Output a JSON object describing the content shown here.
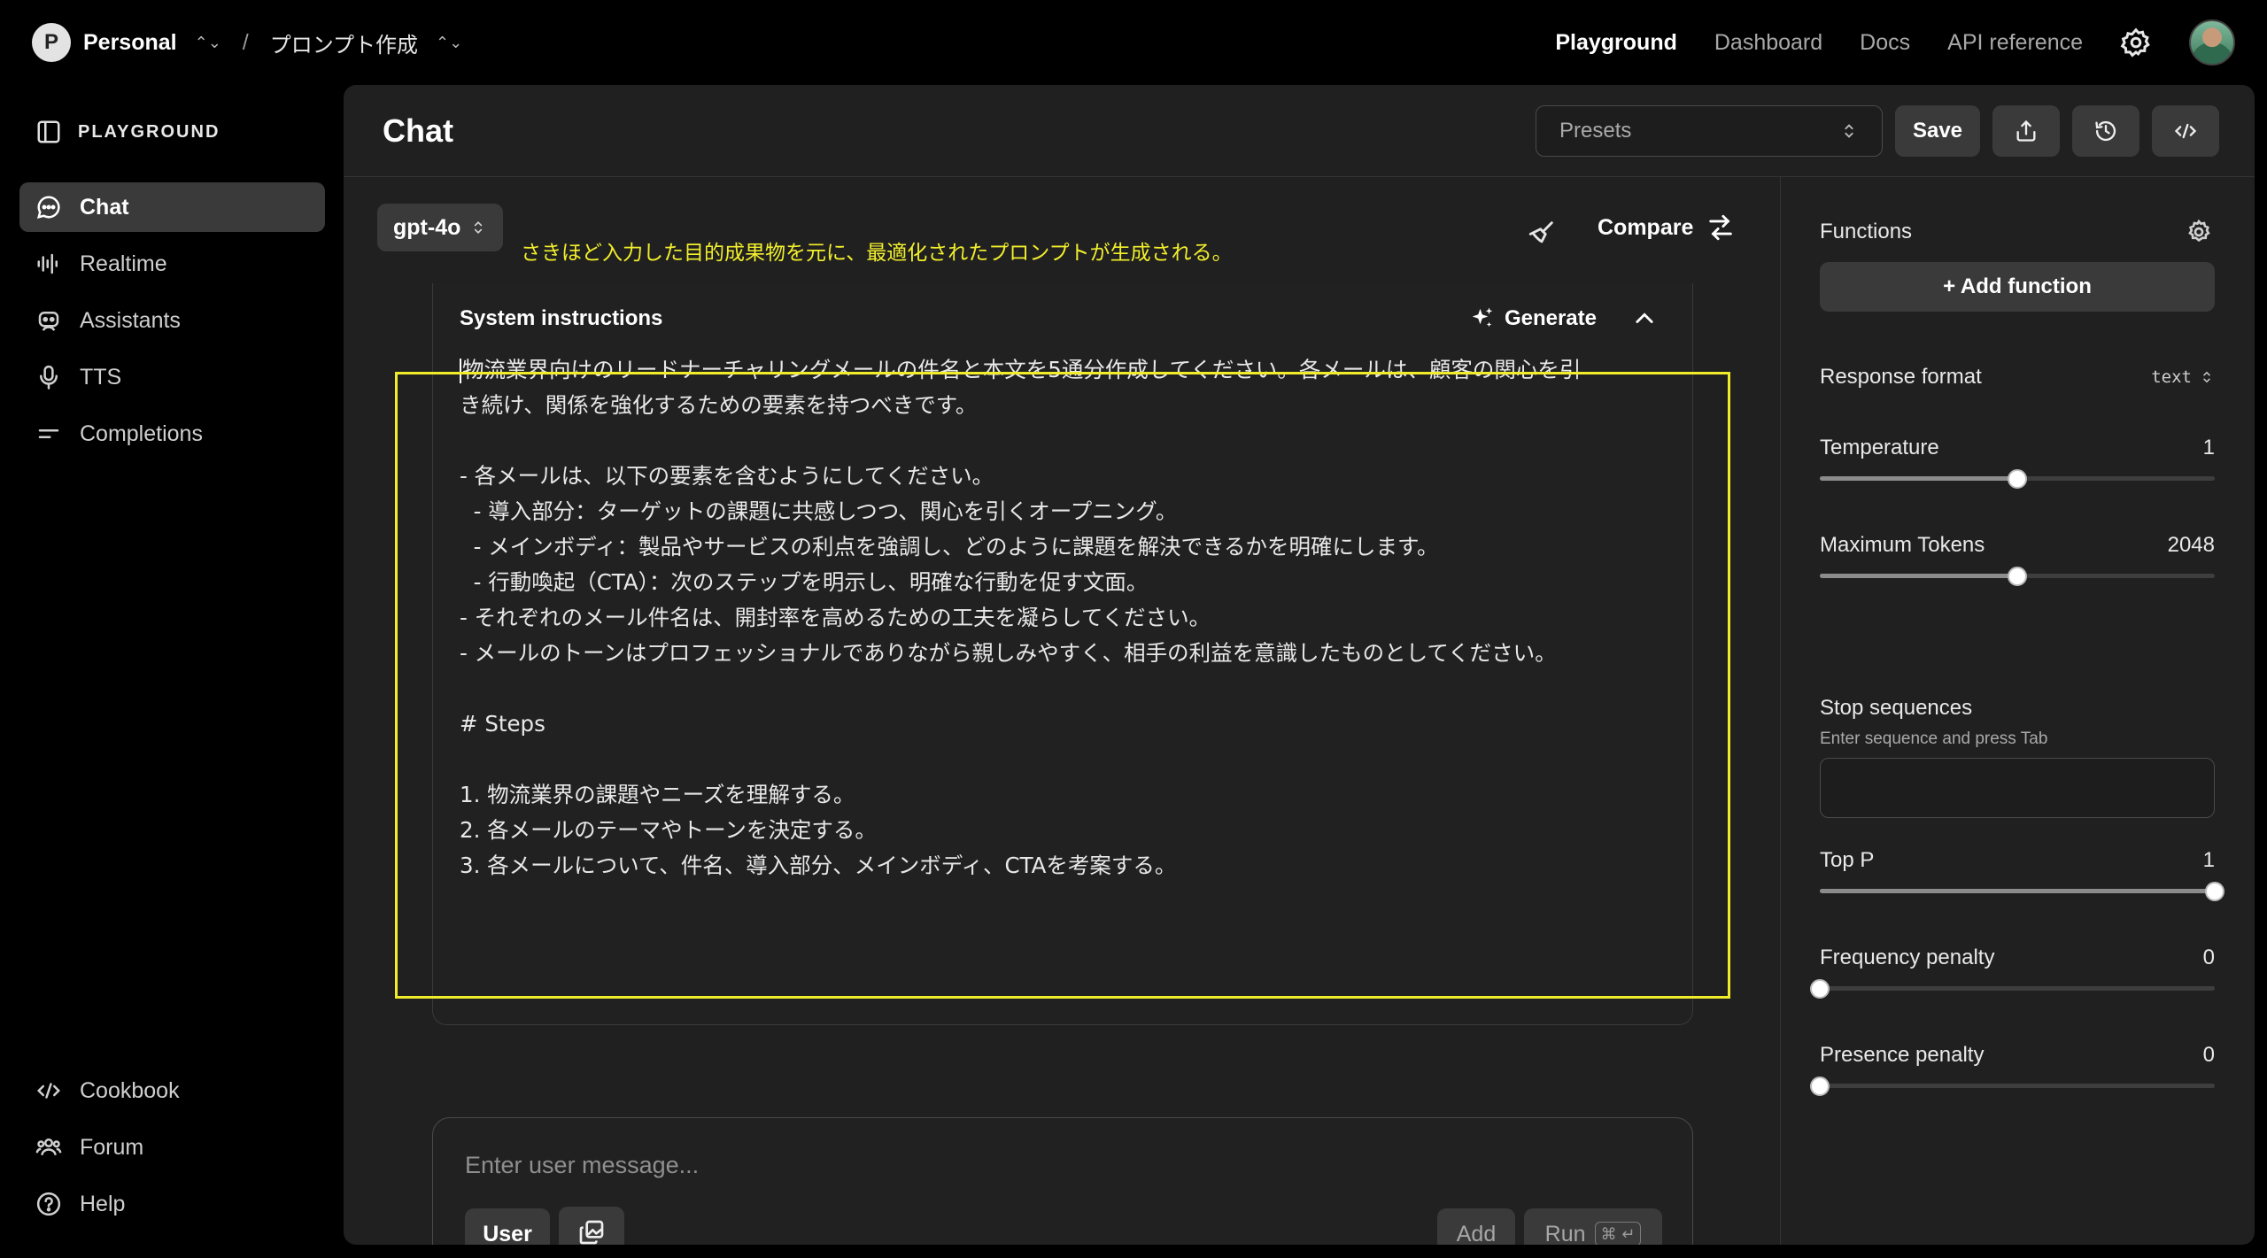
{
  "topbar": {
    "org_initial": "P",
    "org_name": "Personal",
    "project_name": "プロンプト作成",
    "nav": [
      "Playground",
      "Dashboard",
      "Docs",
      "API reference"
    ],
    "active_nav": "Playground"
  },
  "sidebar": {
    "title": "PLAYGROUND",
    "items": [
      {
        "label": "Chat",
        "icon": "chat-bubble-icon",
        "active": true
      },
      {
        "label": "Realtime",
        "icon": "waveform-icon",
        "active": false
      },
      {
        "label": "Assistants",
        "icon": "robot-icon",
        "active": false
      },
      {
        "label": "TTS",
        "icon": "microphone-icon",
        "active": false
      },
      {
        "label": "Completions",
        "icon": "text-lines-icon",
        "active": false
      }
    ],
    "bottom_items": [
      {
        "label": "Cookbook",
        "icon": "code-icon"
      },
      {
        "label": "Forum",
        "icon": "people-icon"
      },
      {
        "label": "Help",
        "icon": "question-circle-icon"
      }
    ]
  },
  "main": {
    "title": "Chat",
    "presets_placeholder": "Presets",
    "save_label": "Save",
    "model": "gpt-4o",
    "annotation": "さきほど入力した目的成果物を元に、最適化されたプロンプトが生成される。",
    "compare_label": "Compare",
    "system": {
      "title": "System instructions",
      "generate_label": "Generate",
      "lines": [
        "物流業界向けのリードナーチャリングメールの件名と本文を5通分作成してください。各メールは、顧客の関心を引",
        "き続け、関係を強化するための要素を持つべきです。",
        "",
        "- 各メールは、以下の要素を含むようにしてください。",
        "  - 導入部分：ターゲットの課題に共感しつつ、関心を引くオープニング。",
        "  - メインボディ：製品やサービスの利点を強調し、どのように課題を解決できるかを明確にします。",
        "  - 行動喚起（CTA）：次のステップを明示し、明確な行動を促す文面。",
        "- それぞれのメール件名は、開封率を高めるための工夫を凝らしてください。",
        "- メールのトーンはプロフェッショナルでありながら親しみやすく、相手の利益を意識したものとしてください。",
        "",
        "# Steps",
        "",
        "1. 物流業界の課題やニーズを理解する。",
        "2. 各メールのテーマやトーンを決定する。",
        "3. 各メールについて、件名、導入部分、メインボディ、CTAを考案する。"
      ]
    },
    "composer": {
      "placeholder": "Enter user message...",
      "role_label": "User",
      "add_label": "Add",
      "run_label": "Run",
      "run_shortcut": "⌘ ↵"
    }
  },
  "settings": {
    "functions_label": "Functions",
    "add_function_label": "+ Add function",
    "response_format_label": "Response format",
    "response_format_value": "text",
    "temperature": {
      "label": "Temperature",
      "value": "1",
      "fraction": 0.5
    },
    "max_tokens": {
      "label": "Maximum Tokens",
      "value": "2048",
      "fraction": 0.5
    },
    "stop_sequences": {
      "label": "Stop sequences",
      "hint": "Enter sequence and press Tab"
    },
    "top_p": {
      "label": "Top P",
      "value": "1",
      "fraction": 1.0
    },
    "frequency_penalty": {
      "label": "Frequency penalty",
      "value": "0",
      "fraction": 0.0
    },
    "presence_penalty": {
      "label": "Presence penalty",
      "value": "0",
      "fraction": 0.0
    }
  },
  "colors": {
    "background": "#000000",
    "panel": "#202020",
    "button": "#3a3a3b",
    "annotation_highlight": "#f0ec29"
  }
}
